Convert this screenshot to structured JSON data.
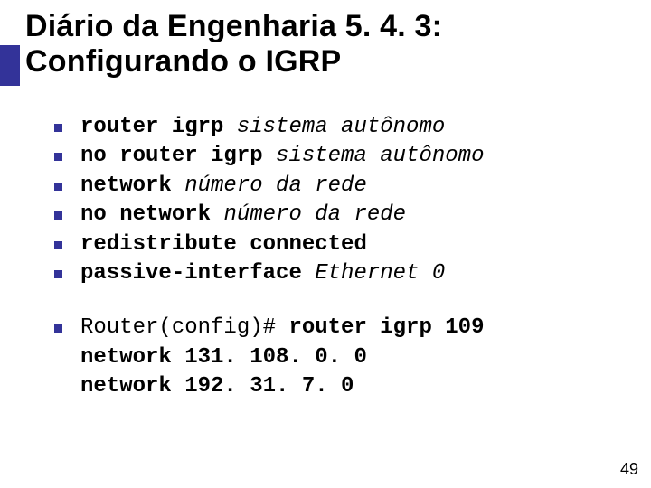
{
  "title": "Diário da Engenharia 5. 4. 3: Configurando o IGRP",
  "group1": {
    "item1_bold": "router igrp ",
    "item1_ital": "sistema autônomo",
    "item2_bold": "no router igrp ",
    "item2_ital": "sistema autônomo",
    "item3_bold": "network ",
    "item3_ital": "número da rede",
    "item4_bold": "no network ",
    "item4_ital": "número da rede",
    "item5_bold": "redistribute connected",
    "item6_bold": "passive-interface ",
    "item6_ital": "Ethernet 0"
  },
  "group2": {
    "line1_plain": "Router(config)# ",
    "line1_bold": "router igrp 109",
    "line2": "network 131. 108. 0. 0",
    "line3": "network 192. 31. 7. 0"
  },
  "page_number": "49",
  "colors": {
    "accent": "#333399"
  }
}
